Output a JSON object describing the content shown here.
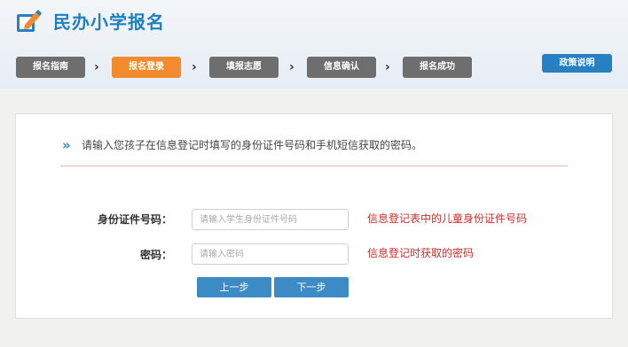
{
  "header": {
    "app_title": "民办小学报名",
    "policy_button": "政策说明"
  },
  "steps": [
    {
      "label": "报名指南",
      "active": false
    },
    {
      "label": "报名登录",
      "active": true
    },
    {
      "label": "填报志愿",
      "active": false
    },
    {
      "label": "信息确认",
      "active": false
    },
    {
      "label": "报名成功",
      "active": false
    }
  ],
  "form": {
    "instruction": "请输入您孩子在信息登记时填写的身份证件号码和手机短信获取的密码。",
    "id_label": "身份证件号码：",
    "id_placeholder": "请输入学生身份证件号码",
    "id_value": "",
    "id_hint": "信息登记表中的儿童身份证件号码",
    "password_label": "密码：",
    "password_placeholder": "请输入密码",
    "password_value": "",
    "password_hint": "信息登记时获取的密码",
    "prev_button": "上一步",
    "next_button": "下一步"
  },
  "colors": {
    "brand_blue": "#1f7fbf",
    "active_step": "#f28a2e",
    "inactive_step": "#6e6e6e",
    "hint_red": "#d02b2b",
    "button_blue": "#3d8bc4"
  }
}
